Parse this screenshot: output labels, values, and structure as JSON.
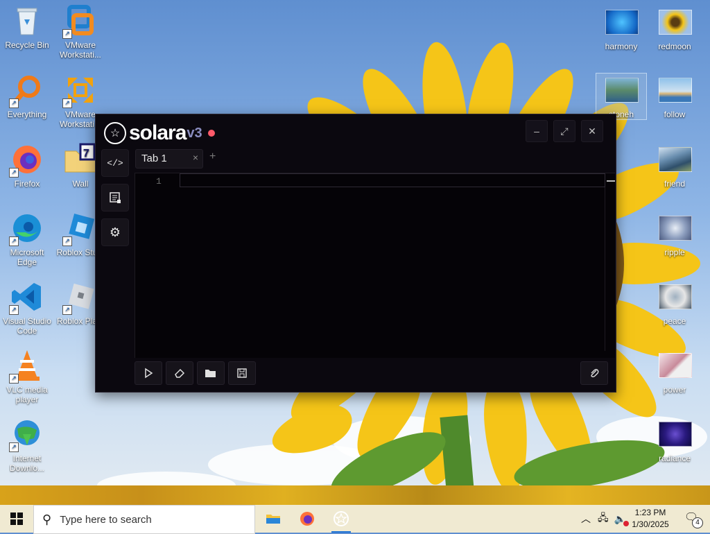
{
  "desktop": {
    "left_icons": [
      {
        "label": "Recycle Bin"
      },
      {
        "label": "VMware Workstati..."
      },
      {
        "label": "Everything"
      },
      {
        "label": "VMware Workstati..."
      },
      {
        "label": "Firefox"
      },
      {
        "label": "Wall"
      },
      {
        "label": "Microsoft Edge"
      },
      {
        "label": "Roblox Stu..."
      },
      {
        "label": "Visual Studio Code"
      },
      {
        "label": "Roblox Pla..."
      },
      {
        "label": "VLC media player"
      },
      {
        "label": "Internet Downlo..."
      }
    ],
    "right_icons": [
      {
        "label": "harmony"
      },
      {
        "label": "redmoon"
      },
      {
        "label": "stoneh"
      },
      {
        "label": "follow"
      },
      {
        "label": "friend"
      },
      {
        "label": "ripple"
      },
      {
        "label": "peace"
      },
      {
        "label": "power"
      },
      {
        "label": "radiance"
      }
    ]
  },
  "window": {
    "app_name": "solara",
    "version": "v3",
    "tab_label": "Tab 1",
    "tab_close": "×",
    "tab_add": "+",
    "line_number": "1",
    "minimize": "–",
    "maximize": "⤢",
    "close": "✕"
  },
  "taskbar": {
    "search_placeholder": "Type here to search",
    "time": "1:23 PM",
    "date": "1/30/2025",
    "notification_count": "4"
  },
  "colors": {
    "accent_dot": "#ff5a6a",
    "version": "#8a8dc0",
    "taskbar": "#f0ead2"
  }
}
